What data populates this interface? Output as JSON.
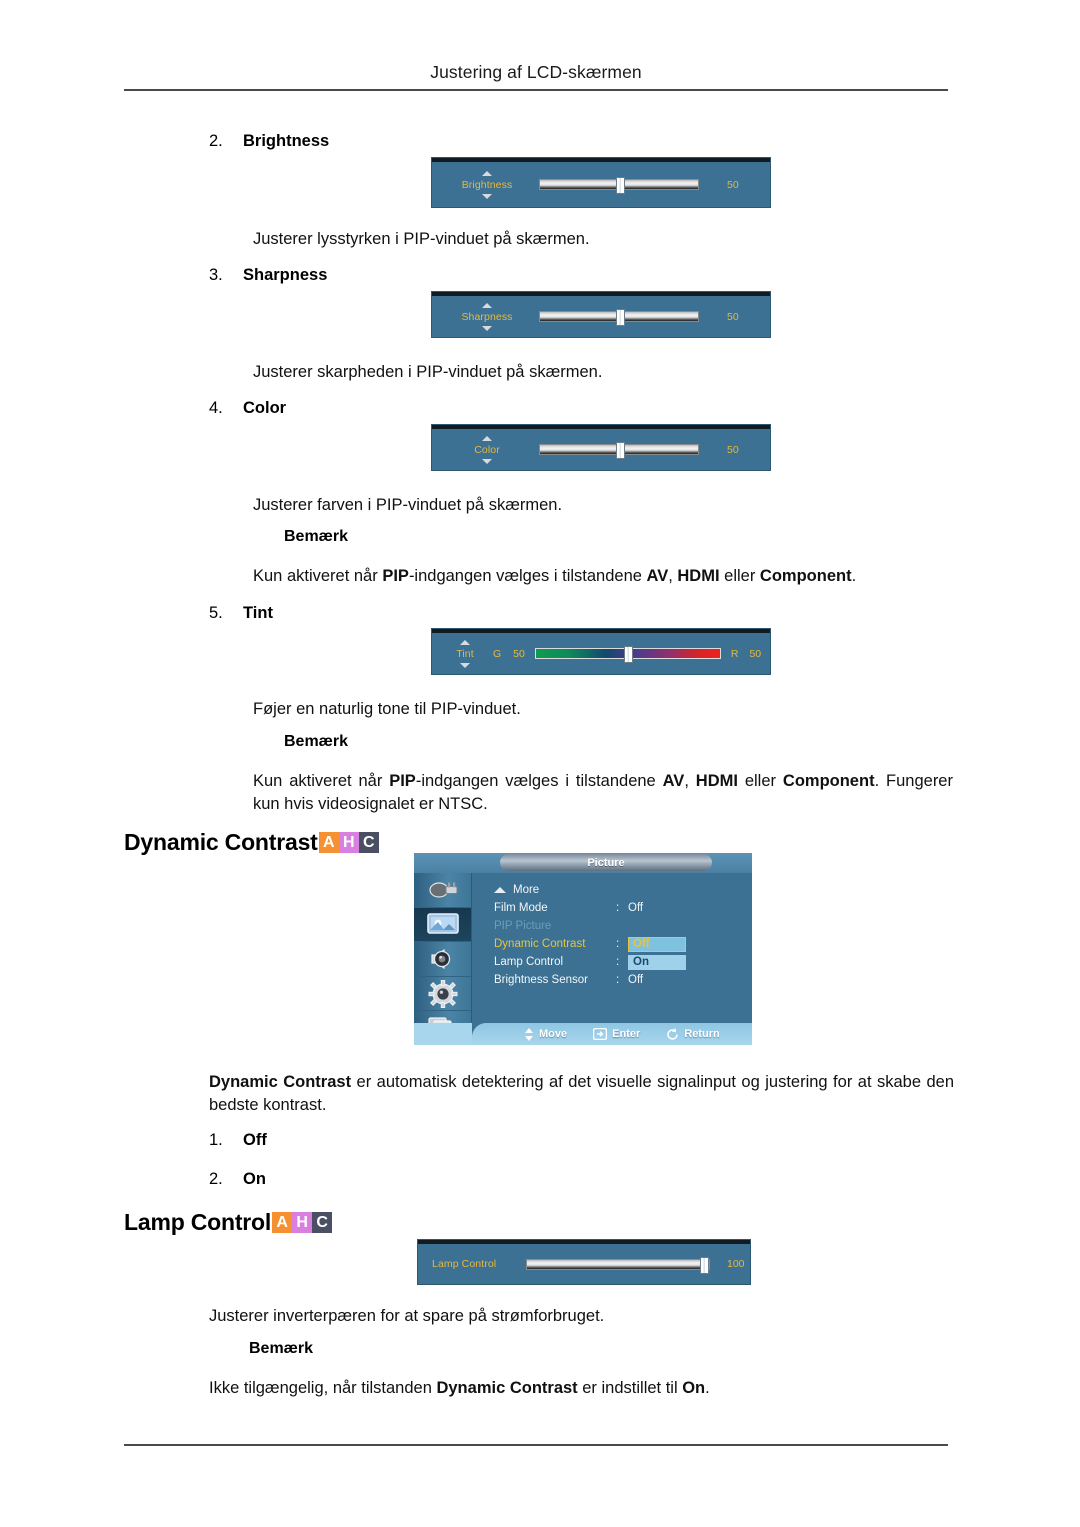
{
  "header": {
    "title": "Justering af LCD-skærmen"
  },
  "items": [
    {
      "num": "2.",
      "title": "Brightness",
      "desc": "Justerer lysstyrken i PIP-vinduet på skærmen.",
      "slider": {
        "label": "Brightness",
        "value": "50",
        "arrows": true
      }
    },
    {
      "num": "3.",
      "title": "Sharpness",
      "desc": "Justerer skarpheden i PIP-vinduet på skærmen.",
      "slider": {
        "label": "Sharpness",
        "value": "50",
        "arrows": true
      }
    },
    {
      "num": "4.",
      "title": "Color",
      "desc": "Justerer farven i PIP-vinduet på skærmen.",
      "slider": {
        "label": "Color",
        "value": "50",
        "arrows": true
      }
    },
    {
      "num": "5.",
      "title": "Tint",
      "desc": "Føjer en naturlig tone til PIP-vinduet.",
      "slider": {
        "label": "Tint",
        "left_letter": "G",
        "left_value": "50",
        "right_letter": "R",
        "right_value": "50",
        "arrows": true
      }
    }
  ],
  "notes": {
    "label": "Bemærk",
    "note1": {
      "p1": "Kun aktiveret når ",
      "b1": "PIP",
      "p2": "-indgangen vælges i tilstandene ",
      "b2": "AV",
      "p3": ", ",
      "b3": "HDMI",
      "p4": " eller ",
      "b4": "Component",
      "p5": "."
    },
    "note2": {
      "p1": "Kun aktiveret når ",
      "b1": "PIP",
      "p2": "-indgangen vælges i tilstandene ",
      "b2": "AV",
      "p3": ", ",
      "b3": "HDMI",
      "p4": " eller ",
      "b4": "Component",
      "p5": ". Fungerer kun hvis videosignalet er NTSC."
    },
    "note3": {
      "p1": "Ikke tilgængelig, når tilstanden ",
      "b1": "Dynamic Contrast",
      "p2": " er indstillet til ",
      "b2": "On",
      "p3": "."
    }
  },
  "badges": {
    "a": "A",
    "h": "H",
    "c": "C"
  },
  "dynamic_contrast": {
    "heading": "Dynamic Contrast",
    "desc_bold": "Dynamic Contrast",
    "desc_rest": " er automatisk detektering af det visuelle signalinput og justering for at skabe den bedste kontrast.",
    "options": [
      {
        "num": "1.",
        "label": "Off"
      },
      {
        "num": "2.",
        "label": "On"
      }
    ]
  },
  "lamp_control": {
    "heading": "Lamp Control",
    "desc": "Justerer inverterpæren for at spare på strømforbruget.",
    "slider": {
      "label": "Lamp Control",
      "value": "100",
      "arrows": false
    }
  },
  "osd_menu": {
    "title": "Picture",
    "more_label": "More",
    "rows": [
      {
        "key": "Film Mode",
        "sep": ":",
        "value": "Off",
        "state": "normal"
      },
      {
        "key": "PIP Picture",
        "sep": "",
        "value": "",
        "state": "dim"
      },
      {
        "key": "Dynamic Contrast",
        "sep": ":",
        "value": "Off",
        "state": "active"
      },
      {
        "key": "Lamp Control",
        "sep": ":",
        "value": "On",
        "state": "selected"
      },
      {
        "key": "Brightness Sensor",
        "sep": ":",
        "value": "Off",
        "state": "normal"
      }
    ],
    "footer": [
      {
        "icon": "move-icon",
        "label": "Move"
      },
      {
        "icon": "enter-icon",
        "label": "Enter"
      },
      {
        "icon": "return-icon",
        "label": "Return"
      }
    ],
    "icons": [
      {
        "name": "input-icon"
      },
      {
        "name": "picture-icon"
      },
      {
        "name": "sound-icon"
      },
      {
        "name": "setup-icon"
      },
      {
        "name": "multicontrol-icon"
      }
    ]
  },
  "colors": {
    "osd_blue": "#3C7193",
    "osd_yellow": "#E8B83C",
    "badge_a": "#F59133",
    "badge_h": "#D97FE0",
    "badge_c": "#4A4F63"
  }
}
